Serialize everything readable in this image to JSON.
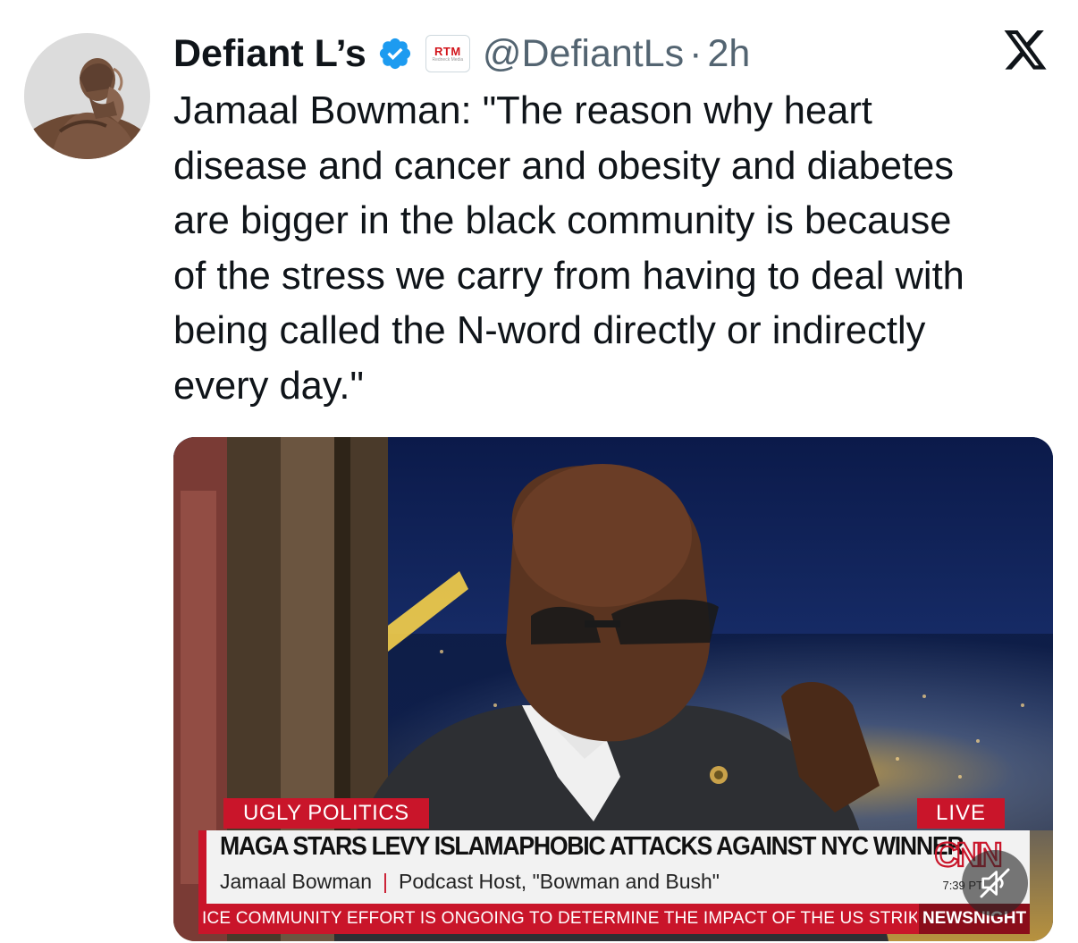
{
  "tweet": {
    "display_name": "Defiant L’s",
    "affiliate_badge": "RTM",
    "affiliate_badge_sub": "Redneck Media",
    "handle": "@DefiantLs",
    "separator": "·",
    "timestamp": "2h",
    "text": "Jamaal Bowman: \"The reason why heart\ndisease and cancer and obesity and diabetes\nare bigger in the black community is because\nof the stress we carry from having to deal with\nbeing called the N-word directly or indirectly\nevery day.\""
  },
  "video": {
    "show_tag": "UGLY POLITICS",
    "live_tag": "LIVE",
    "headline": "MAGA STARS LEVY ISLAMAPHOBIC ATTACKS AGAINST NYC WINNER",
    "guest_name": "Jamaal Bowman",
    "guest_sep": "|",
    "guest_title": "Podcast Host, \"Bowman and Bush\"",
    "network_logo": "CNN",
    "clock": "7:39 PT",
    "ticker": "ICE COMMUNITY EFFORT IS ONGOING TO DETERMINE THE IMPACT OF THE US STRIKES O",
    "ticker_brand": "NEWSNIGHT",
    "muted": true
  },
  "icons": {
    "verified": "verified-badge-icon",
    "x_logo": "x-logo-icon",
    "mute": "speaker-muted-icon"
  },
  "colors": {
    "verified_blue": "#1d9bf0",
    "cnn_red": "#c9152a",
    "secondary_text": "#536471"
  }
}
